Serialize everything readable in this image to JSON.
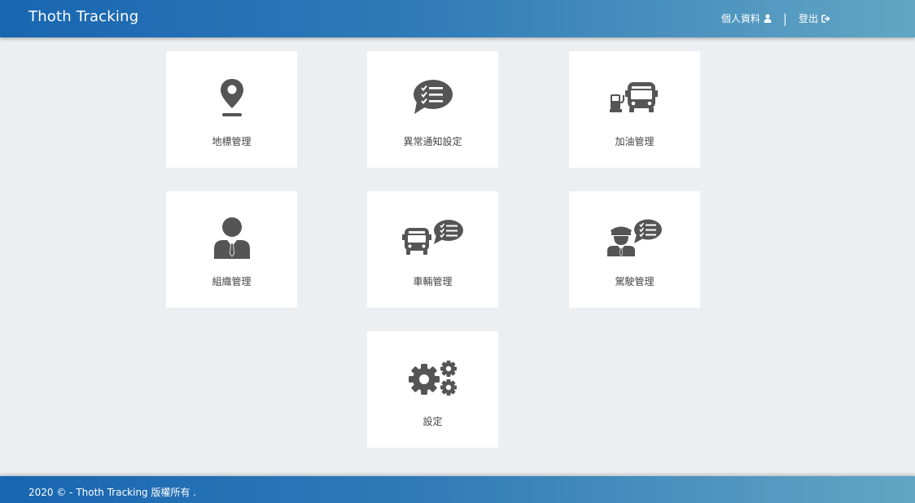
{
  "header": {
    "brand": "Thoth Tracking",
    "profile_label": "個人資料",
    "profile_icon": "user-icon",
    "separator": "|",
    "logout_label": "登出",
    "logout_icon": "sign-out-icon"
  },
  "menu": [
    {
      "label": "地標管理",
      "icon": "map-marker-icon"
    },
    {
      "label": "異常通知設定",
      "icon": "chat-checklist-icon"
    },
    {
      "label": "加油管理",
      "icon": "fuel-bus-icon"
    },
    {
      "label": "組織管理",
      "icon": "person-tie-icon"
    },
    {
      "label": "車輛管理",
      "icon": "bus-chat-icon"
    },
    {
      "label": "駕駛管理",
      "icon": "driver-chat-icon"
    },
    {
      "label": "設定",
      "icon": "gears-icon"
    }
  ],
  "footer": {
    "text": "2020 © - Thoth Tracking 版權所有 ."
  },
  "colors": {
    "header_start": "#1866b0",
    "header_end": "#62a6c4",
    "background": "#eceff2",
    "icon": "#555555"
  }
}
